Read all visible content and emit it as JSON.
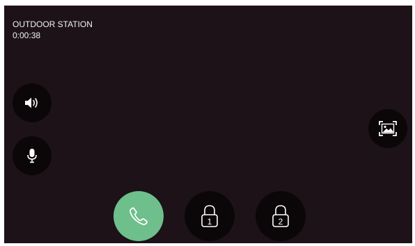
{
  "call": {
    "source": "OUTDOOR STATION",
    "duration": "0:00:38"
  },
  "controls": {
    "speaker_icon": "speaker-icon",
    "microphone_icon": "microphone-icon",
    "snapshot_icon": "picture-icon",
    "answer_icon": "phone-handset-icon",
    "unlock_buttons": [
      {
        "icon": "padlock-icon",
        "number": "1"
      },
      {
        "icon": "padlock-icon",
        "number": "2"
      }
    ]
  },
  "colors": {
    "background": "#1c1218",
    "button": "#0b0709",
    "answer": "#6ebf8b",
    "text": "#f2f2f2"
  }
}
